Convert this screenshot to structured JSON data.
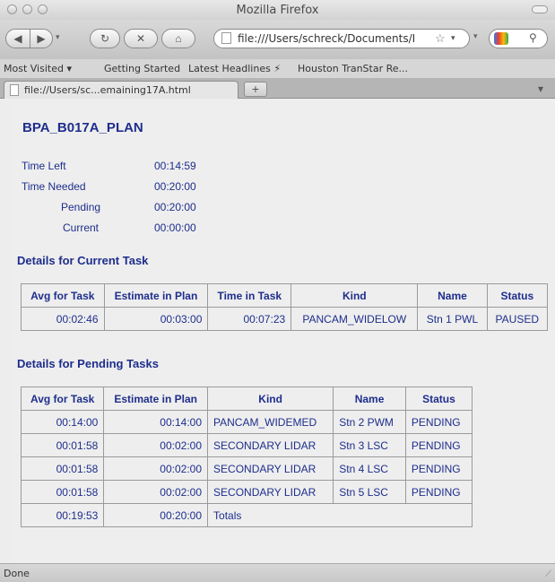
{
  "window": {
    "title": "Mozilla Firefox"
  },
  "nav": {
    "url": "file:///Users/schreck/Documents/RemainingTime/timeRemaining17A.html",
    "url_display": "file:///Users/schreck/Documents/I"
  },
  "bookmarks": [
    "Most Visited ▾",
    "Getting Started",
    "Latest Headlines ⚡",
    "Houston TranStar Re..."
  ],
  "tab": {
    "label": "file://Users/sc...emaining17A.html"
  },
  "page": {
    "plan_name": "BPA_B017A_PLAN",
    "summary": [
      {
        "label": "Time Left",
        "value": "00:14:59"
      },
      {
        "label": "Time Needed",
        "value": "00:20:00"
      },
      {
        "label": "Pending",
        "value": "00:20:00"
      },
      {
        "label": "Current",
        "value": "00:00:00"
      }
    ],
    "current_title": "Details for Current Task",
    "current_headers": [
      "Avg for Task",
      "Estimate in Plan",
      "Time in Task",
      "Kind",
      "Name",
      "Status"
    ],
    "current_row": [
      "00:02:46",
      "00:03:00",
      "00:07:23",
      "PANCAM_WIDELOW",
      "Stn 1 PWL",
      "PAUSED"
    ],
    "pending_title": "Details for Pending Tasks",
    "pending_headers": [
      "Avg for Task",
      "Estimate in Plan",
      "Kind",
      "Name",
      "Status"
    ],
    "pending_rows": [
      [
        "00:14:00",
        "00:14:00",
        "PANCAM_WIDEMED",
        "Stn 2 PWM",
        "PENDING"
      ],
      [
        "00:01:58",
        "00:02:00",
        "SECONDARY LIDAR",
        "Stn 3 LSC",
        "PENDING"
      ],
      [
        "00:01:58",
        "00:02:00",
        "SECONDARY LIDAR",
        "Stn 4 LSC",
        "PENDING"
      ],
      [
        "00:01:58",
        "00:02:00",
        "SECONDARY LIDAR",
        "Stn 5 LSC",
        "PENDING"
      ]
    ],
    "totals_row": [
      "00:19:53",
      "00:20:00",
      "Totals"
    ]
  },
  "status": {
    "text": "Done"
  }
}
